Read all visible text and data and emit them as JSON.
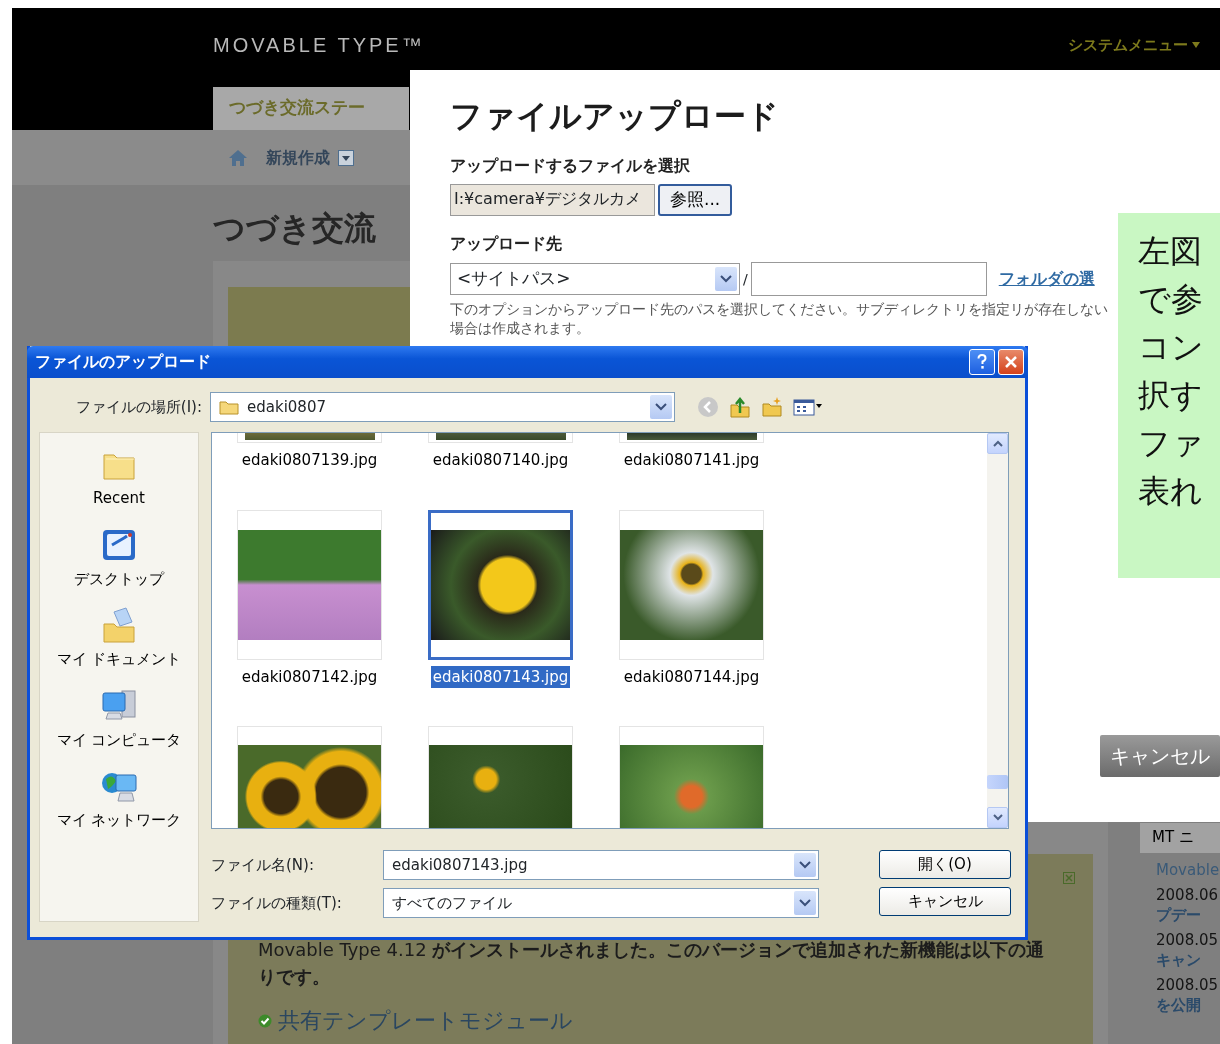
{
  "mt_page": {
    "logo": "MOVABLE TYPE™",
    "system_menu": "システムメニュー",
    "blog_tab": "つづき交流ステー",
    "new_entry_menu": "新規作成",
    "page_title": "つづき交流",
    "news": {
      "text": "Movable Type 4.12 **がインストールされました。このバージョンで追加された新機能は以下の通りです。**",
      "feature": "共有テンプレートモジュール"
    },
    "news_sidebar": {
      "title": "MT ニ",
      "entries": [
        {
          "kind": "link",
          "text": "Movable"
        },
        {
          "kind": "date",
          "text": "2008.06"
        },
        {
          "kind": "title",
          "text": "プデー"
        },
        {
          "kind": "date",
          "text": "2008.05"
        },
        {
          "kind": "title",
          "text": "キャン"
        },
        {
          "kind": "date",
          "text": "2008.05"
        },
        {
          "kind": "title",
          "text": "を公開"
        }
      ]
    }
  },
  "upload_modal": {
    "title": "ファイルアップロード",
    "file_label": "アップロードするファイルを選択",
    "file_value": "I:¥camera¥デジタルカメ",
    "browse_button": "参照...",
    "dest_label": "アップロード先",
    "dest_select": "<サイトパス>",
    "separator": "/",
    "folder_link": "フォルダの選",
    "help": "下のオプションからアップロード先のパスを選択してください。サブディレクトリを指定リが存在しない場合は作成されます。",
    "cancel_button": "キャンセル"
  },
  "annotation": {
    "lines": [
      "左図",
      "で参",
      "コン",
      "択す",
      "ファ",
      "表れ"
    ]
  },
  "file_dialog": {
    "title": "ファイルのアップロード",
    "location_label": "ファイルの場所(I):",
    "location": "edaki0807",
    "places": [
      {
        "kind": "recent",
        "label": "Recent"
      },
      {
        "kind": "desktop",
        "label": "デスクトップ"
      },
      {
        "kind": "documents",
        "label": "マイ ドキュメント"
      },
      {
        "kind": "computer",
        "label": "マイ コンピュータ"
      },
      {
        "kind": "network",
        "label": "マイ ネットワーク"
      }
    ],
    "files": [
      {
        "kind": "cut_top",
        "name": "edaki0807139.jpg",
        "selected": false
      },
      {
        "kind": "cut_top",
        "name": "edaki0807140.jpg",
        "selected": false
      },
      {
        "kind": "cut_top",
        "name": "edaki0807141.jpg",
        "selected": false
      },
      {
        "kind": "whole",
        "name": "edaki0807142.jpg",
        "selected": false
      },
      {
        "kind": "whole",
        "name": "edaki0807143.jpg",
        "selected": true
      },
      {
        "kind": "whole",
        "name": "edaki0807144.jpg",
        "selected": false
      },
      {
        "kind": "cut_bottom",
        "selected": false
      },
      {
        "kind": "cut_bottom",
        "selected": false
      },
      {
        "kind": "cut_bottom",
        "selected": false
      }
    ],
    "file_name_label": "ファイル名(N):",
    "file_name": "edaki0807143.jpg",
    "file_type_label": "ファイルの種類(T):",
    "file_type": "すべてのファイル",
    "open_button": "開く(O)",
    "cancel_button": "キャンセル"
  }
}
